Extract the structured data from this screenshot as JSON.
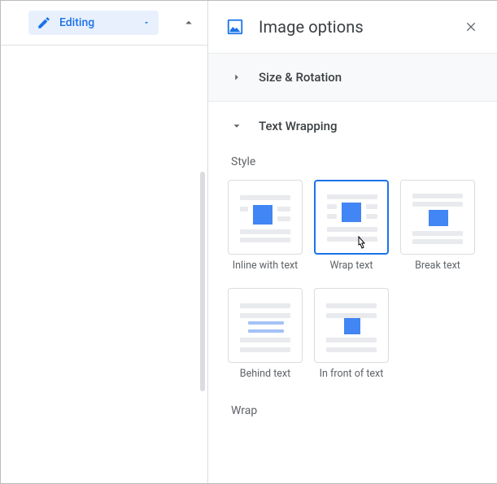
{
  "toolbar": {
    "mode_label": "Editing"
  },
  "panel": {
    "title": "Image options",
    "sections": {
      "size_rotation": {
        "title": "Size & Rotation"
      },
      "text_wrapping": {
        "title": "Text Wrapping",
        "style_label": "Style",
        "wrap_label": "Wrap",
        "options": [
          {
            "label": "Inline with text"
          },
          {
            "label": "Wrap text"
          },
          {
            "label": "Break text"
          },
          {
            "label": "Behind text"
          },
          {
            "label": "In front of text"
          }
        ]
      }
    }
  }
}
